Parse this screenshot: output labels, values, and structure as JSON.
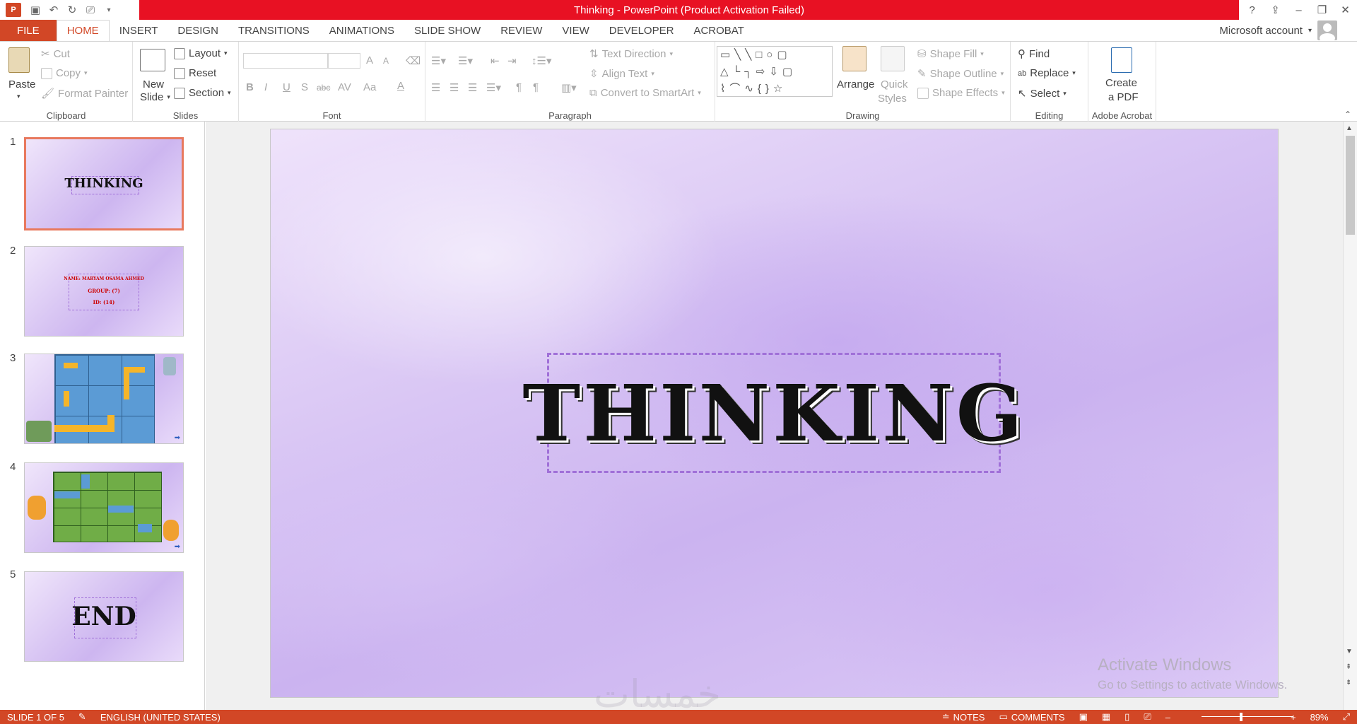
{
  "app": {
    "logo": "P",
    "title": "Thinking -  PowerPoint (Product Activation Failed)",
    "help": "?",
    "account": "Microsoft account"
  },
  "tabs": [
    "FILE",
    "HOME",
    "INSERT",
    "DESIGN",
    "TRANSITIONS",
    "ANIMATIONS",
    "SLIDE SHOW",
    "REVIEW",
    "VIEW",
    "DEVELOPER",
    "ACROBAT"
  ],
  "ribbon": {
    "clipboard": {
      "paste": "Paste",
      "cut": "Cut",
      "copy": "Copy",
      "format_painter": "Format Painter",
      "label": "Clipboard"
    },
    "slides": {
      "new_slide_1": "New",
      "new_slide_2": "Slide",
      "layout": "Layout",
      "reset": "Reset",
      "section": "Section",
      "label": "Slides"
    },
    "font": {
      "label": "Font",
      "bold": "B",
      "italic": "I",
      "underline": "U",
      "shadow": "S",
      "strike": "abc",
      "spacing": "AV",
      "case": "Aa",
      "color": "A",
      "grow": "A",
      "shrink": "A"
    },
    "paragraph": {
      "text_direction": "Text Direction",
      "align_text": "Align Text",
      "convert_smartart": "Convert to SmartArt",
      "label": "Paragraph"
    },
    "drawing": {
      "arrange": "Arrange",
      "quick_styles_1": "Quick",
      "quick_styles_2": "Styles",
      "shape_fill": "Shape Fill",
      "shape_outline": "Shape Outline",
      "shape_effects": "Shape Effects",
      "label": "Drawing"
    },
    "editing": {
      "find": "Find",
      "replace": "Replace",
      "select": "Select",
      "label": "Editing"
    },
    "acrobat": {
      "create_1": "Create",
      "create_2": "a PDF",
      "label": "Adobe Acrobat"
    }
  },
  "slides": [
    {
      "num": "1",
      "text": "THINKING"
    },
    {
      "num": "2",
      "lines": [
        "NAME: MARYAM OSAMA AHMED",
        "GROUP: (7)",
        "ID: (14)"
      ]
    },
    {
      "num": "3"
    },
    {
      "num": "4"
    },
    {
      "num": "5",
      "text": "END"
    }
  ],
  "slide": {
    "title": "THINKING"
  },
  "watermark": {
    "activate": "Activate Windows",
    "goto": "Go to Settings to activate Windows.",
    "logo": "خمسات"
  },
  "status": {
    "slide": "SLIDE 1 OF 5",
    "language": "ENGLISH (UNITED STATES)",
    "notes": "NOTES",
    "comments": "COMMENTS",
    "zoom": "89%"
  },
  "colors": {
    "accent": "#d24726",
    "title_bar": "#e81123",
    "slide_bg": "#d9c6f4",
    "title_border": "#a070d8"
  }
}
